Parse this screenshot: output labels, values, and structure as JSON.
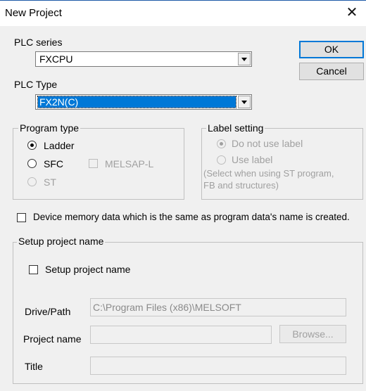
{
  "dialog": {
    "title": "New Project"
  },
  "plc_series": {
    "label": "PLC series",
    "value": "FXCPU"
  },
  "plc_type": {
    "label": "PLC Type",
    "value": "FX2N(C)"
  },
  "buttons": {
    "ok": "OK",
    "cancel": "Cancel",
    "browse": "Browse..."
  },
  "program_type": {
    "legend": "Program type",
    "ladder": "Ladder",
    "sfc": "SFC",
    "st": "ST",
    "melsap": "MELSAP-L",
    "selected": "Ladder"
  },
  "label_setting": {
    "legend": "Label setting",
    "do_not_use": "Do not use label",
    "use": "Use label",
    "note_line1": "(Select when using ST program,",
    "note_line2": "FB and structures)"
  },
  "device_memory": {
    "label": "Device memory data which is the same as program data's name is created."
  },
  "setup_project": {
    "legend": "Setup project name",
    "checkbox_label": "Setup project name",
    "drive_path_label": "Drive/Path",
    "drive_path_value": "C:\\Program Files (x86)\\MELSOFT",
    "project_name_label": "Project name",
    "project_name_value": "",
    "title_label": "Title",
    "title_value": ""
  }
}
